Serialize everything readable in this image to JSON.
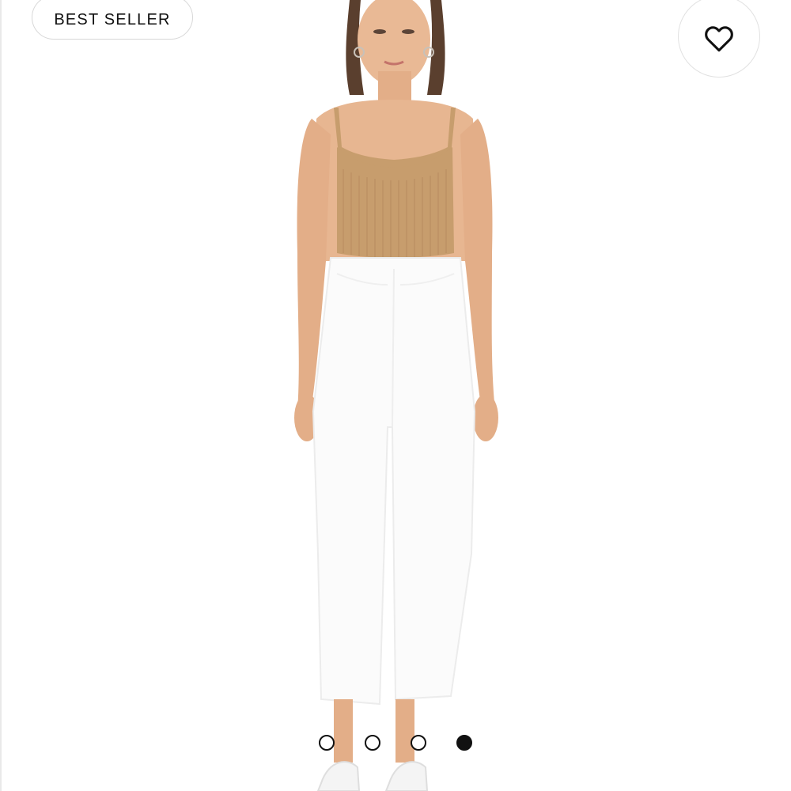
{
  "badge": {
    "label": "BEST SELLER"
  },
  "favorite": {
    "icon": "heart-outline-icon"
  },
  "product_image": {
    "alt": ""
  },
  "carousel": {
    "dot_count": 4,
    "active_index": 4,
    "active_color": "#111111",
    "inactive_color": "#ffffff"
  },
  "colors": {
    "background": "#ffffff",
    "badge_border": "#d7d7d7",
    "top": "#c79d6d",
    "pants": "#ffffff",
    "skin": "#e7b691"
  }
}
